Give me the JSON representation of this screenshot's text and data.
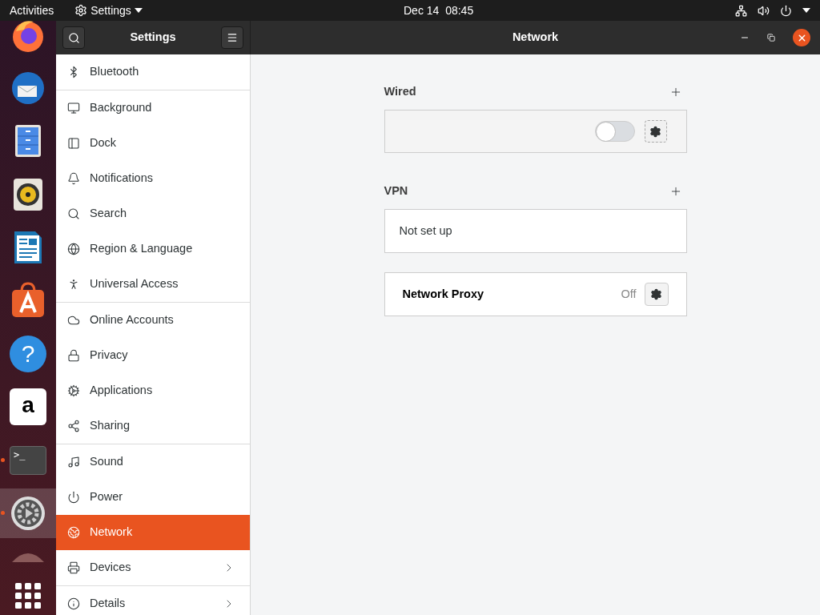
{
  "top_bar": {
    "activities": "Activities",
    "app_menu": "Settings",
    "clock": "Dec 14  08:45"
  },
  "dock": [
    {
      "kind": "firefox",
      "running": false,
      "active": false
    },
    {
      "kind": "thunderbird",
      "running": false,
      "active": false
    },
    {
      "kind": "files",
      "running": false,
      "active": false
    },
    {
      "kind": "rhythmbox",
      "running": false,
      "active": false
    },
    {
      "kind": "writer",
      "running": false,
      "active": false
    },
    {
      "kind": "software",
      "running": false,
      "active": false
    },
    {
      "kind": "help",
      "glyph": "?",
      "running": false,
      "active": false
    },
    {
      "kind": "amazon",
      "glyph": "a",
      "running": false,
      "active": false
    },
    {
      "kind": "terminal",
      "glyph": ">_",
      "running": true,
      "active": false
    },
    {
      "kind": "settings",
      "running": true,
      "active": true
    },
    {
      "kind": "partial",
      "running": false,
      "active": false
    },
    {
      "kind": "grid",
      "running": false,
      "active": false
    }
  ],
  "sidebar": {
    "title": "Settings",
    "groups": [
      [
        {
          "label": "Bluetooth",
          "selected": false,
          "submenu": false
        }
      ],
      [
        {
          "label": "Background",
          "selected": false,
          "submenu": false
        },
        {
          "label": "Dock",
          "selected": false,
          "submenu": false
        },
        {
          "label": "Notifications",
          "selected": false,
          "submenu": false
        },
        {
          "label": "Search",
          "selected": false,
          "submenu": false
        },
        {
          "label": "Region & Language",
          "selected": false,
          "submenu": false
        },
        {
          "label": "Universal Access",
          "selected": false,
          "submenu": false
        }
      ],
      [
        {
          "label": "Online Accounts",
          "selected": false,
          "submenu": false
        },
        {
          "label": "Privacy",
          "selected": false,
          "submenu": false
        },
        {
          "label": "Applications",
          "selected": false,
          "submenu": false
        },
        {
          "label": "Sharing",
          "selected": false,
          "submenu": false
        }
      ],
      [
        {
          "label": "Sound",
          "selected": false,
          "submenu": false
        },
        {
          "label": "Power",
          "selected": false,
          "submenu": false
        },
        {
          "label": "Network",
          "selected": true,
          "submenu": false
        },
        {
          "label": "Devices",
          "selected": false,
          "submenu": true
        }
      ],
      [
        {
          "label": "Details",
          "selected": false,
          "submenu": true
        }
      ]
    ]
  },
  "main": {
    "title": "Network",
    "wired": {
      "heading": "Wired",
      "on": false
    },
    "vpn": {
      "heading": "VPN",
      "status": "Not set up"
    },
    "proxy": {
      "label": "Network Proxy",
      "status": "Off"
    }
  }
}
